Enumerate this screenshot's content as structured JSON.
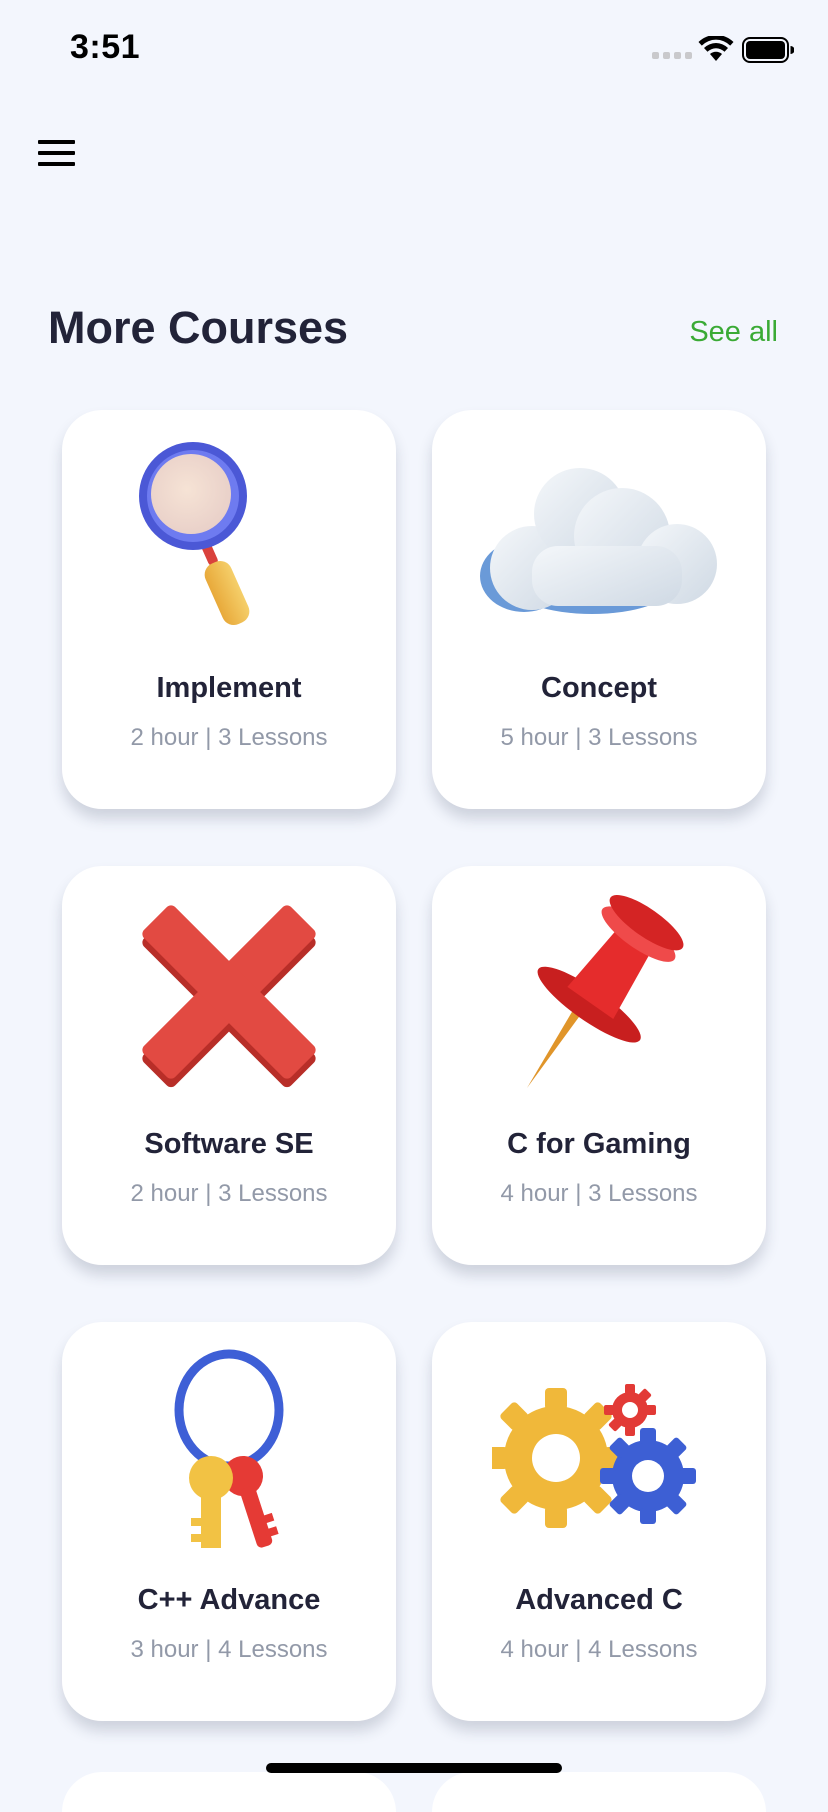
{
  "status_bar": {
    "time": "3:51"
  },
  "header": {
    "menu_icon": "hamburger-menu-icon"
  },
  "section": {
    "title": "More Courses",
    "see_all": "See all",
    "see_all_color": "#3aaa35"
  },
  "courses": [
    {
      "title": "Implement",
      "meta": "2 hour | 3 Lessons",
      "icon": "magnifying-glass-icon"
    },
    {
      "title": "Concept",
      "meta": "5 hour | 3 Lessons",
      "icon": "cloud-icon"
    },
    {
      "title": "Software SE",
      "meta": "2 hour | 3 Lessons",
      "icon": "red-x-icon"
    },
    {
      "title": "C for Gaming",
      "meta": "4 hour | 3 Lessons",
      "icon": "pushpin-icon"
    },
    {
      "title": "C++ Advance",
      "meta": "3 hour | 4 Lessons",
      "icon": "keys-icon"
    },
    {
      "title": "Advanced C",
      "meta": "4 hour | 4 Lessons",
      "icon": "gears-icon"
    }
  ]
}
